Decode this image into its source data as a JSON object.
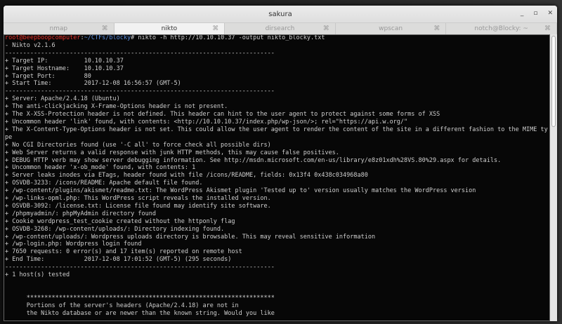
{
  "window": {
    "title": "sakura",
    "min": "_",
    "max": "▫",
    "close": "✕"
  },
  "tabs": [
    {
      "label": "nmap",
      "active": false
    },
    {
      "label": "nikto",
      "active": true
    },
    {
      "label": "dirsearch",
      "active": false
    },
    {
      "label": "wpscan",
      "active": false
    },
    {
      "label": "notch@Blocky: ~",
      "active": false
    }
  ],
  "tab_close": "⌘",
  "prompt": {
    "user_host": "root@beepboopcomputer",
    "sep": ":",
    "path": "~/CTFs/blocky",
    "symbol": "# ",
    "command": "nikto -h http://10.10.10.37 -output nikto_blocky.txt"
  },
  "output": [
    "- Nikto v2.1.6",
    "---------------------------------------------------------------------------",
    "+ Target IP:          10.10.10.37",
    "+ Target Hostname:    10.10.10.37",
    "+ Target Port:        80",
    "+ Start Time:         2017-12-08 16:56:57 (GMT-5)",
    "---------------------------------------------------------------------------",
    "+ Server: Apache/2.4.18 (Ubuntu)",
    "+ The anti-clickjacking X-Frame-Options header is not present.",
    "+ The X-XSS-Protection header is not defined. This header can hint to the user agent to protect against some forms of XSS",
    "+ Uncommon header 'link' found, with contents: <http://10.10.10.37/index.php/wp-json/>; rel=\"https://api.w.org/\"",
    "+ The X-Content-Type-Options header is not set. This could allow the user agent to render the content of the site in a different fashion to the MIME ty",
    "pe",
    "+ No CGI Directories found (use '-C all' to force check all possible dirs)",
    "+ Web Server returns a valid response with junk HTTP methods, this may cause false positives.",
    "+ DEBUG HTTP verb may show server debugging information. See http://msdn.microsoft.com/en-us/library/e8z01xdh%28VS.80%29.aspx for details.",
    "+ Uncommon header 'x-ob_mode' found, with contents: 1",
    "+ Server leaks inodes via ETags, header found with file /icons/README, fields: 0x13f4 0x438c034968a80",
    "+ OSVDB-3233: /icons/README: Apache default file found.",
    "+ /wp-content/plugins/akismet/readme.txt: The WordPress Akismet plugin 'Tested up to' version usually matches the WordPress version",
    "+ /wp-links-opml.php: This WordPress script reveals the installed version.",
    "+ OSVDB-3092: /license.txt: License file found may identify site software.",
    "+ /phpmyadmin/: phpMyAdmin directory found",
    "+ Cookie wordpress_test_cookie created without the httponly flag",
    "+ OSVDB-3268: /wp-content/uploads/: Directory indexing found.",
    "+ /wp-content/uploads/: Wordpress uploads directory is browsable. This may reveal sensitive information",
    "+ /wp-login.php: Wordpress login found",
    "+ 7650 requests: 0 error(s) and 17 item(s) reported on remote host",
    "+ End Time:           2017-12-08 17:01:52 (GMT-5) (295 seconds)",
    "---------------------------------------------------------------------------",
    "+ 1 host(s) tested",
    "",
    "",
    "      *********************************************************************",
    "      Portions of the server's headers (Apache/2.4.18) are not in",
    "      the Nikto database or are newer than the known string. Would you like"
  ]
}
